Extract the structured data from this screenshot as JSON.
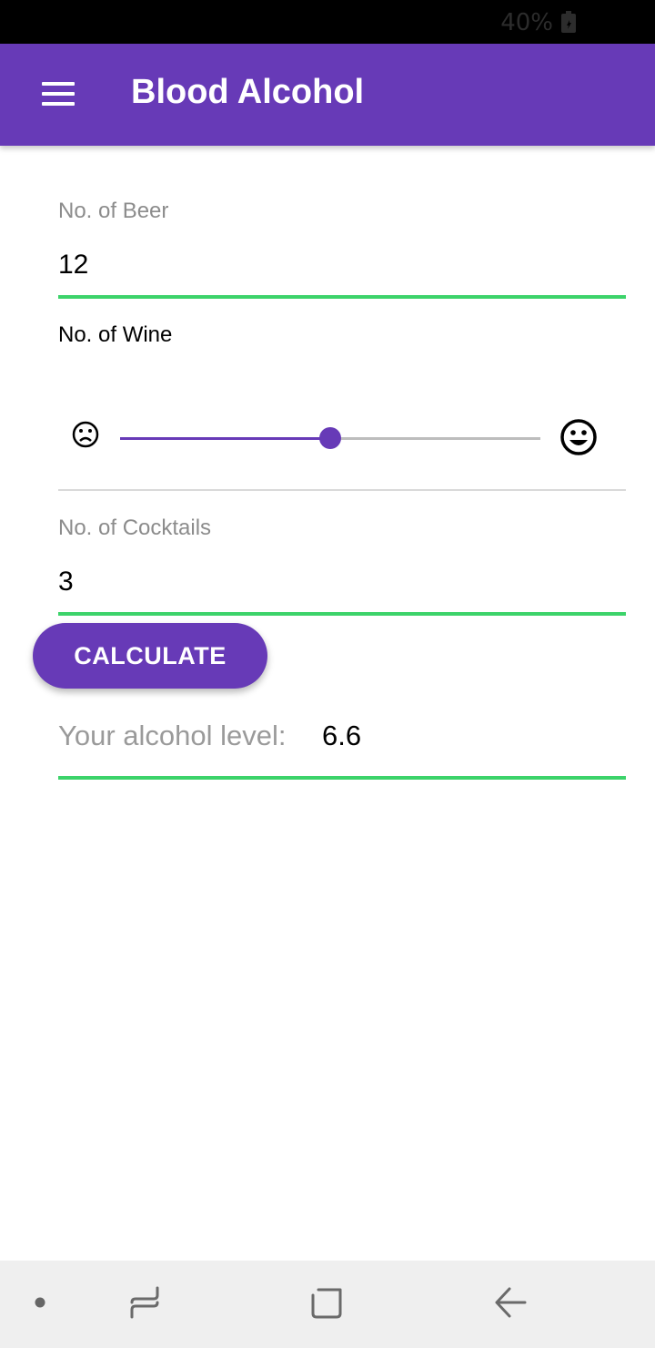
{
  "status_bar": {
    "battery_text": "40%",
    "battery_icon": "battery-charging-icon"
  },
  "app_bar": {
    "title": "Blood Alcohol",
    "menu_icon": "hamburger-menu-icon",
    "color": "#673ab7"
  },
  "form": {
    "beer": {
      "label": "No. of Beer",
      "value": "12"
    },
    "wine": {
      "label": "No. of Wine",
      "slider_value_fraction": 0.5,
      "left_icon": "sad-face-icon",
      "right_icon": "happy-face-icon"
    },
    "cocktails": {
      "label": "No. of Cocktails",
      "value": "3"
    },
    "calculate_label": "CALCULATE"
  },
  "result": {
    "label": "Your alcohol level:",
    "value": "6.6"
  },
  "nav_bar": {
    "icons": [
      "dot-icon",
      "recent-apps-icon",
      "home-icon",
      "back-arrow-icon"
    ]
  },
  "colors": {
    "primary": "#673ab7",
    "underline": "#3cd36a"
  }
}
